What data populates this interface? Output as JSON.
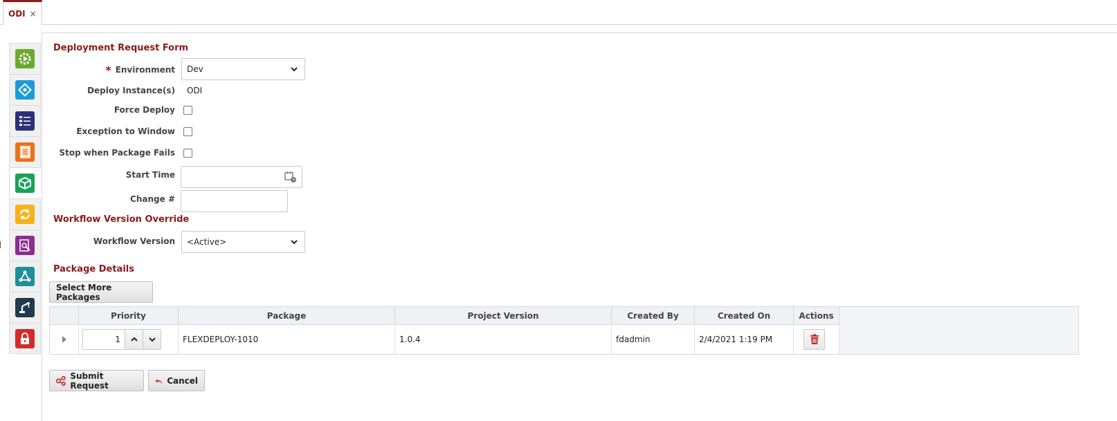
{
  "tab": {
    "label": "ODI",
    "close": "×"
  },
  "sidebar": {
    "items": [
      {
        "name": "sidebar-item-execution",
        "icon": "gear-play-icon",
        "color": "#6aaa2e"
      },
      {
        "name": "sidebar-item-integrations",
        "icon": "link-diamond-icon",
        "color": "#1e9bd7"
      },
      {
        "name": "sidebar-item-checklist",
        "icon": "checklist-icon",
        "color": "#2c2f7a"
      },
      {
        "name": "sidebar-item-notes",
        "icon": "notebook-icon",
        "color": "#e8731a"
      },
      {
        "name": "sidebar-item-packages",
        "icon": "package-cube-icon",
        "color": "#1aa05a"
      },
      {
        "name": "sidebar-item-sync",
        "icon": "sync-icon",
        "color": "#f4b21c"
      },
      {
        "name": "sidebar-item-reports",
        "icon": "report-search-icon",
        "color": "#8a2e8e"
      },
      {
        "name": "sidebar-item-pipeline",
        "icon": "flow-nodes-icon",
        "color": "#1f8f9c"
      },
      {
        "name": "sidebar-item-automation",
        "icon": "robot-arm-icon",
        "color": "#1f3b4d"
      },
      {
        "name": "sidebar-item-security",
        "icon": "lock-icon",
        "color": "#d42a2a"
      }
    ]
  },
  "form": {
    "title": "Deployment Request Form",
    "environment": {
      "label": "Environment",
      "value": "Dev"
    },
    "deploy_instances": {
      "label": "Deploy Instance(s)",
      "value": "ODI"
    },
    "force_deploy": {
      "label": "Force Deploy"
    },
    "exception_window": {
      "label": "Exception to Window"
    },
    "stop_on_fail": {
      "label": "Stop when Package Fails"
    },
    "start_time": {
      "label": "Start Time",
      "value": ""
    },
    "change_number": {
      "label": "Change #",
      "value": ""
    }
  },
  "workflow": {
    "title": "Workflow Version Override",
    "version": {
      "label": "Workflow Version",
      "value": "<Active>"
    }
  },
  "packages": {
    "title": "Package Details",
    "select_more_label": "Select More Packages",
    "columns": [
      "Priority",
      "Package",
      "Project Version",
      "Created By",
      "Created On",
      "Actions"
    ],
    "rows": [
      {
        "priority": "1",
        "package": "FLEXDEPLOY-1010",
        "project_version": "1.0.4",
        "created_by": "fdadmin",
        "created_on": "2/4/2021 1:19 PM"
      }
    ]
  },
  "actions": {
    "submit_label": "Submit Request",
    "cancel_label": "Cancel"
  },
  "colors": {
    "accent": "#8b1a1a",
    "header_bg": "#eef1f5"
  }
}
